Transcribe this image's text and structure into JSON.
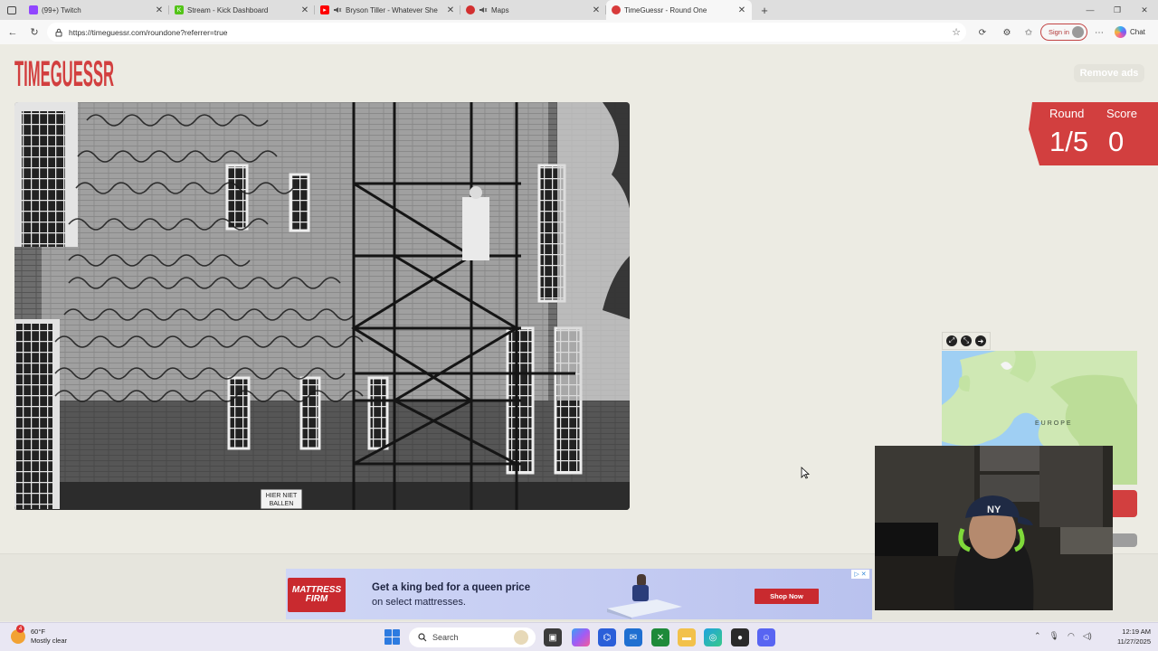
{
  "browser": {
    "tabs": [
      {
        "title": "(99+) Twitch",
        "favicon_color": "#9146ff",
        "active": false
      },
      {
        "title": "Stream - Kick Dashboard",
        "favicon_color": "#53fc18",
        "active": false
      },
      {
        "title": "Bryson Tiller - Whatever She",
        "favicon_color": "#ff0000",
        "active": false
      },
      {
        "title": "Maps",
        "favicon_color": "#d22f2f",
        "active": false
      },
      {
        "title": "TimeGuessr - Round One",
        "favicon_color": "#d83b3b",
        "active": true
      }
    ],
    "new_tab_label": "+",
    "url": "https://timeguessr.com/roundone?referrer=true",
    "sign_in_label": "Sign in",
    "chat_label": "Chat"
  },
  "page": {
    "logo_text": "TIMEGUESSR",
    "remove_ads_label": "Remove ads",
    "accent_color": "#d23f3f",
    "score_panel": {
      "round_label": "Round",
      "round_value": "1/5",
      "score_label": "Score",
      "score_value": "0"
    },
    "photo": {
      "alt": "Black and white photo of a brick building facade with a handwritten mural and scaffolding",
      "sign_text": "HIER NIET BALLEN"
    },
    "map": {
      "region_label": "EUROPE",
      "controls": [
        "expand-icon",
        "collapse-icon",
        "pin-icon"
      ]
    }
  },
  "ad": {
    "brand_line1": "MATTRESS",
    "brand_line2": "FIRM",
    "headline": "Get a king bed for a queen price",
    "subline": "on select mattresses.",
    "cta": "Shop Now",
    "choices_label": "▷ ✕"
  },
  "taskbar": {
    "weather_temp": "60°F",
    "weather_desc": "Mostly clear",
    "weather_badge": "4",
    "search_placeholder": "Search",
    "time": "12:19 AM",
    "date": "11/27/2025"
  }
}
